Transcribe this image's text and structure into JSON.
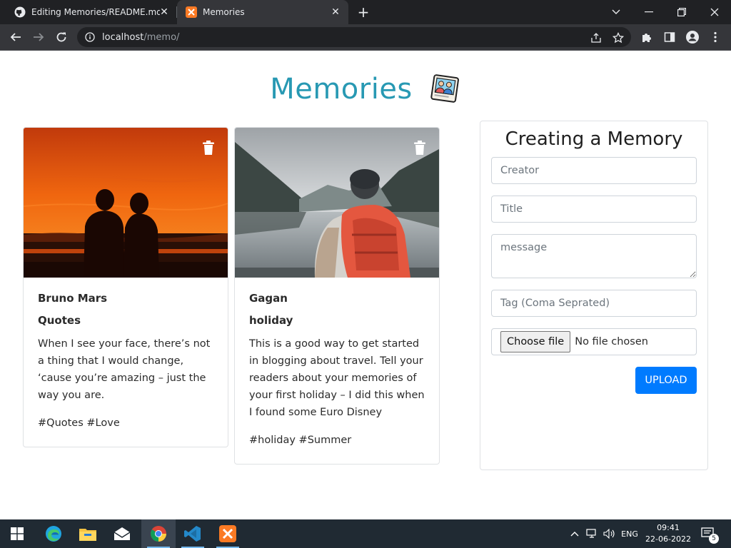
{
  "browser": {
    "tabs": [
      {
        "label": "Editing Memories/README.md at",
        "active": false
      },
      {
        "label": "Memories",
        "active": true
      }
    ],
    "url_host": "localhost",
    "url_path": "/memo/"
  },
  "header": {
    "title": "Memories",
    "icon": "photo-frame-icon"
  },
  "memories": [
    {
      "creator": "Bruno Mars",
      "title": "Quotes",
      "message": "When I see your face, there’s not a thing that I would change, ‘cause you’re amazing – just the way you are.",
      "tags": "#Quotes #Love",
      "image": "sunset-couple-silhouette"
    },
    {
      "creator": "Gagan",
      "title": "holiday",
      "message": "This is a good way to get started in blogging about travel. Tell your readers about your memories of your first holiday – I did this when I found some Euro Disney",
      "tags": "#holiday #Summer",
      "image": "hiker-lake-mountains"
    }
  ],
  "form": {
    "heading": "Creating a Memory",
    "creator_placeholder": "Creator",
    "title_placeholder": "Title",
    "message_placeholder": "message",
    "tags_placeholder": "Tag (Coma Seprated)",
    "file_button": "Choose file",
    "file_status": "No file chosen",
    "submit_label": "UPLOAD"
  },
  "taskbar": {
    "language": "ENG",
    "time": "09:41",
    "date": "22-06-2022",
    "notification_count": "5"
  },
  "colors": {
    "brand": "#2899b3",
    "primary_button": "#007bff"
  }
}
